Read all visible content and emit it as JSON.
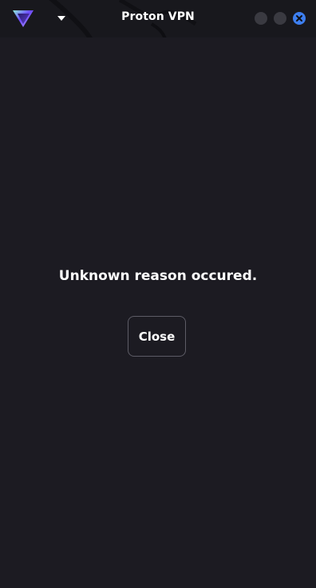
{
  "window": {
    "title": "Proton VPN"
  },
  "titlebar": {
    "logo_icon": "proton-vpn-logo-icon",
    "menu_icon": "caret-down-icon",
    "controls": [
      "minimize",
      "maximize",
      "close"
    ]
  },
  "dialog": {
    "message": "Unknown reason occured.",
    "close_label": "Close"
  },
  "colors": {
    "background": "#1c1b22",
    "titlebar": "#18181d",
    "accent": "#3d7eef",
    "button_border": "#5d5c66",
    "text": "#ffffff"
  }
}
